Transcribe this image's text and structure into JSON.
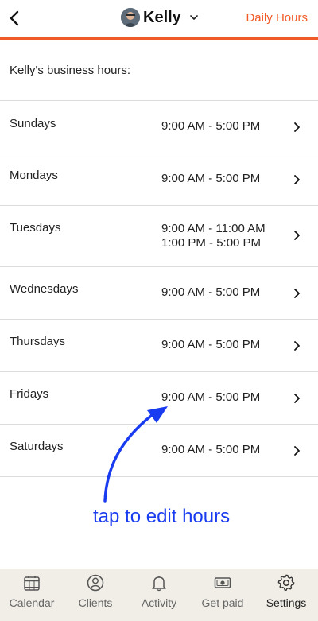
{
  "header": {
    "user_name": "Kelly",
    "action_label": "Daily Hours"
  },
  "intro_text": "Kelly's business hours:",
  "days": [
    {
      "label": "Sundays",
      "hours": [
        "9:00 AM - 5:00 PM"
      ]
    },
    {
      "label": "Mondays",
      "hours": [
        "9:00 AM - 5:00 PM"
      ]
    },
    {
      "label": "Tuesdays",
      "hours": [
        "9:00 AM - 11:00 AM",
        "1:00 PM - 5:00 PM"
      ]
    },
    {
      "label": "Wednesdays",
      "hours": [
        "9:00 AM - 5:00 PM"
      ]
    },
    {
      "label": "Thursdays",
      "hours": [
        "9:00 AM - 5:00 PM"
      ]
    },
    {
      "label": "Fridays",
      "hours": [
        "9:00 AM - 5:00 PM"
      ]
    },
    {
      "label": "Saturdays",
      "hours": [
        "9:00 AM - 5:00 PM"
      ]
    }
  ],
  "annotation": {
    "text": "tap to edit hours",
    "color": "#1a3cf0"
  },
  "tabs": [
    {
      "label": "Calendar",
      "icon": "calendar-icon"
    },
    {
      "label": "Clients",
      "icon": "person-icon"
    },
    {
      "label": "Activity",
      "icon": "bell-icon"
    },
    {
      "label": "Get paid",
      "icon": "money-icon"
    },
    {
      "label": "Settings",
      "icon": "gear-icon",
      "active": true
    }
  ],
  "colors": {
    "accent": "#f15a29",
    "tabbar_bg": "#f1eee7"
  }
}
